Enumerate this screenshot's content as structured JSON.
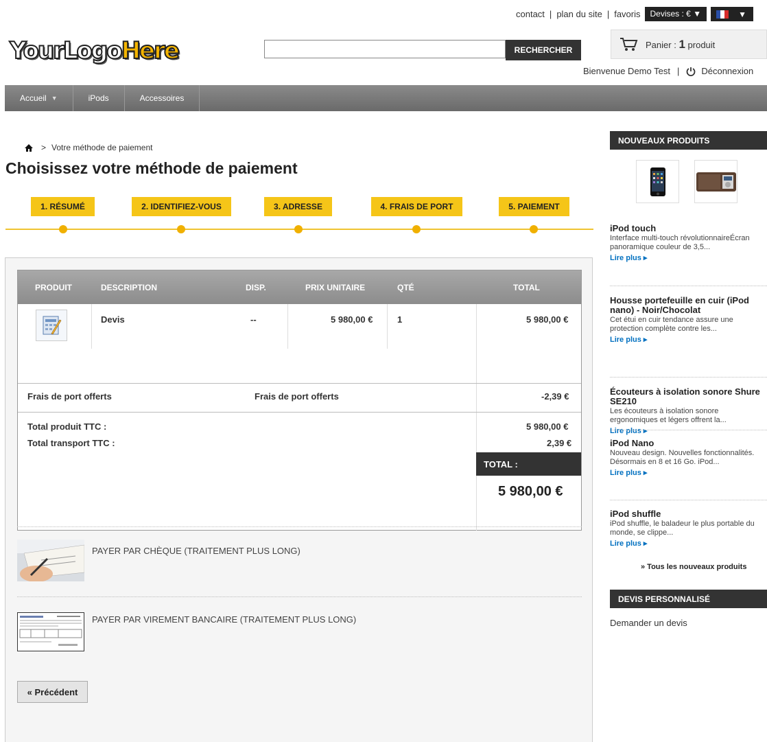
{
  "top_links": {
    "contact": "contact",
    "sitemap": "plan du site",
    "favorites": "favoris",
    "currency": "Devises : € ▼",
    "language_caret": "▼"
  },
  "logo": {
    "part1": "YourLogo",
    "part2": "Here"
  },
  "search": {
    "value": "",
    "button": "RECHERCHER"
  },
  "cart": {
    "label": "Panier :",
    "count": "1",
    "unit": "produit"
  },
  "user": {
    "welcome": "Bienvenue Demo Test",
    "logout": "Déconnexion"
  },
  "nav": {
    "items": [
      "Accueil",
      "iPods",
      "Accessoires"
    ]
  },
  "breadcrumb": {
    "current": "Votre méthode de paiement"
  },
  "page_title": "Choisissez votre méthode de paiement",
  "steps": [
    "1. RÉSUMÉ",
    "2. IDENTIFIEZ-VOUS",
    "3. ADRESSE",
    "4. FRAIS DE PORT",
    "5. PAIEMENT"
  ],
  "cart_table": {
    "headers": [
      "PRODUIT",
      "DESCRIPTION",
      "DISP.",
      "PRIX UNITAIRE",
      "QTÉ",
      "TOTAL"
    ],
    "row": {
      "description": "Devis",
      "availability": "--",
      "unit_price": "5 980,00 €",
      "quantity": "1",
      "total": "5 980,00 €"
    },
    "shipping": {
      "label": "Frais de port offerts",
      "description": "Frais de port offerts",
      "amount": "-2,39 €"
    },
    "total_products_label": "Total produit TTC :",
    "total_products": "5 980,00 €",
    "total_shipping_label": "Total transport TTC :",
    "total_shipping": "2,39 €",
    "total_label": "TOTAL :",
    "grand_total": "5 980,00 €"
  },
  "payment_options": [
    {
      "label": "PAYER PAR CHÈQUE (TRAITEMENT PLUS LONG)"
    },
    {
      "label": "PAYER PAR VIREMENT BANCAIRE (TRAITEMENT PLUS LONG)"
    }
  ],
  "previous_button": "« Précédent",
  "sidebar": {
    "new_products_title": "NOUVEAUX PRODUITS",
    "products": [
      {
        "title": "iPod touch",
        "desc": "Interface multi-touch révolutionnaireÉcran panoramique couleur de 3,5...",
        "more": "Lire plus"
      },
      {
        "title": "Housse portefeuille en cuir (iPod nano) - Noir/Chocolat",
        "desc": "Cet étui en cuir tendance assure une protection complète contre les...",
        "more": "Lire plus"
      },
      {
        "title": "Écouteurs à isolation sonore Shure SE210",
        "desc": "Les écouteurs à isolation sonore ergonomiques et légers offrent la...",
        "more": "Lire plus"
      },
      {
        "title": "iPod Nano",
        "desc": "Nouveau design. Nouvelles fonctionnalités. Désormais en 8 et 16 Go. iPod...",
        "more": "Lire plus"
      },
      {
        "title": "iPod shuffle",
        "desc": "iPod shuffle, le baladeur le plus portable du monde, se clippe...",
        "more": "Lire plus"
      }
    ],
    "all_new_products": "» Tous les nouveaux produits",
    "quote_title": "DEVIS PERSONNALISÉ",
    "quote_link": "Demander un devis"
  }
}
